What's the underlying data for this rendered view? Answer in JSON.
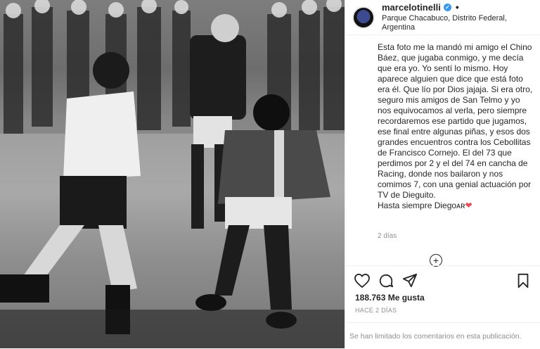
{
  "header": {
    "username": "marcelotinelli",
    "verified_mark": "✓",
    "more_dots": "•",
    "location": "Parque Chacabuco, Distrito Federal, Argentina"
  },
  "caption": {
    "text": "Esta foto me la mandó mi amigo el Chino Báez, que jugaba conmigo, y me decía que era yo. Yo sentí lo mismo. Hoy aparece alguien que dice que está foto era él. Que lío por Dios jajaja. Si era otro, seguro mis amigos de San Telmo y yo nos equivocamos al verla, pero siempre recordaremos ese partido que jugamos, ese final entre algunas piñas, y esos dos grandes encuentros contra los Cebollitas de Francisco Cornejo. El del 73 que perdimos por 2 y el del 74 en cancha de Racing, donde nos bailaron y nos comimos 7, con una genial actuación por TV de Dieguito.",
    "closing": "Hasta siempre Diegoᴀʀ",
    "heart": "❤"
  },
  "comment_age": "2 días",
  "load_more_symbol": "+",
  "actions": {
    "like_icon": "heart-outline-icon",
    "comment_icon": "comment-icon",
    "share_icon": "paper-plane-icon",
    "save_icon": "bookmark-icon"
  },
  "likes": "188.763 Me gusta",
  "posted_ago": "HACE 2 DÍAS",
  "comments_notice": "Se han limitado los comentarios en esta publicación."
}
